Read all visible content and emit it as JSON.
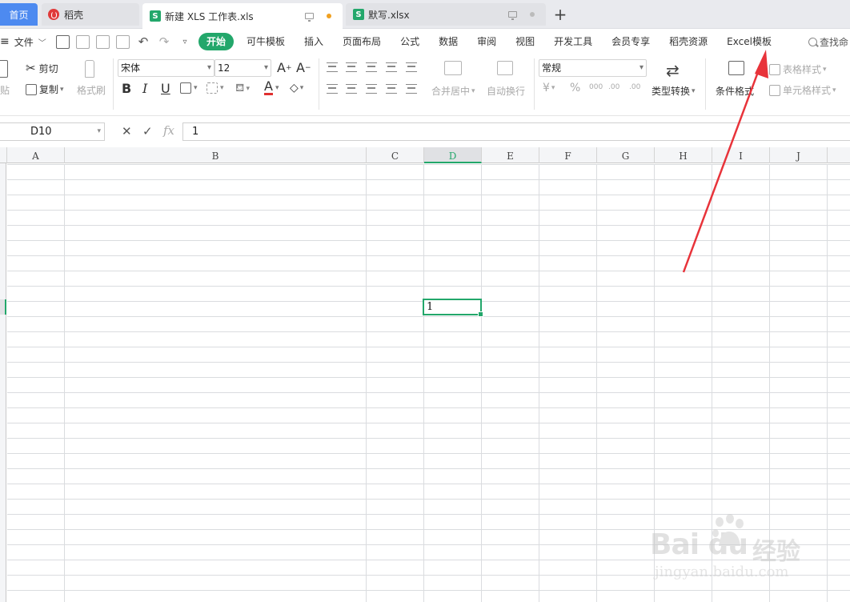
{
  "colors": {
    "accent": "#23a76b",
    "home_tab": "#4d8af0",
    "arrow": "#e8333a"
  },
  "tabs": {
    "home": "首页",
    "daoke": "稻壳",
    "new_workbook": "新建 XLS 工作表.xls",
    "moxie": "默写.xlsx"
  },
  "menu": {
    "file": "文件",
    "items": [
      "开始",
      "可牛模板",
      "插入",
      "页面布局",
      "公式",
      "数据",
      "审阅",
      "视图",
      "开发工具",
      "会员专享",
      "稻壳资源",
      "Excel模板"
    ],
    "search": "查找命"
  },
  "ribbon": {
    "paste": "贴",
    "cut": "剪切",
    "copy": "复制",
    "format_painter": "格式刷",
    "font_name": "宋体",
    "font_size": "12",
    "merge_center": "合并居中",
    "wrap_text": "自动换行",
    "number_format": "常规",
    "type_convert": "类型转换",
    "cond_format": "条件格式",
    "table_style": "表格样式",
    "cell_style": "单元格样式",
    "bold": "B",
    "italic": "I",
    "underline": "U",
    "font_color": "A",
    "percent": "%",
    "thousands": "000",
    "inc_decimal": ".00",
    "dec_decimal": ".00"
  },
  "formula_bar": {
    "cell_ref": "D10",
    "value": "1",
    "cancel": "✕",
    "confirm": "✓",
    "fx": "fx"
  },
  "grid": {
    "columns": [
      "A",
      "B",
      "C",
      "D",
      "E",
      "F",
      "G",
      "H",
      "I",
      "J"
    ],
    "selected_column": "D",
    "active_cell_value": "1"
  },
  "watermark": {
    "logo": "Bai  du",
    "cn": "经验",
    "url": "jingyan.baidu.com"
  }
}
